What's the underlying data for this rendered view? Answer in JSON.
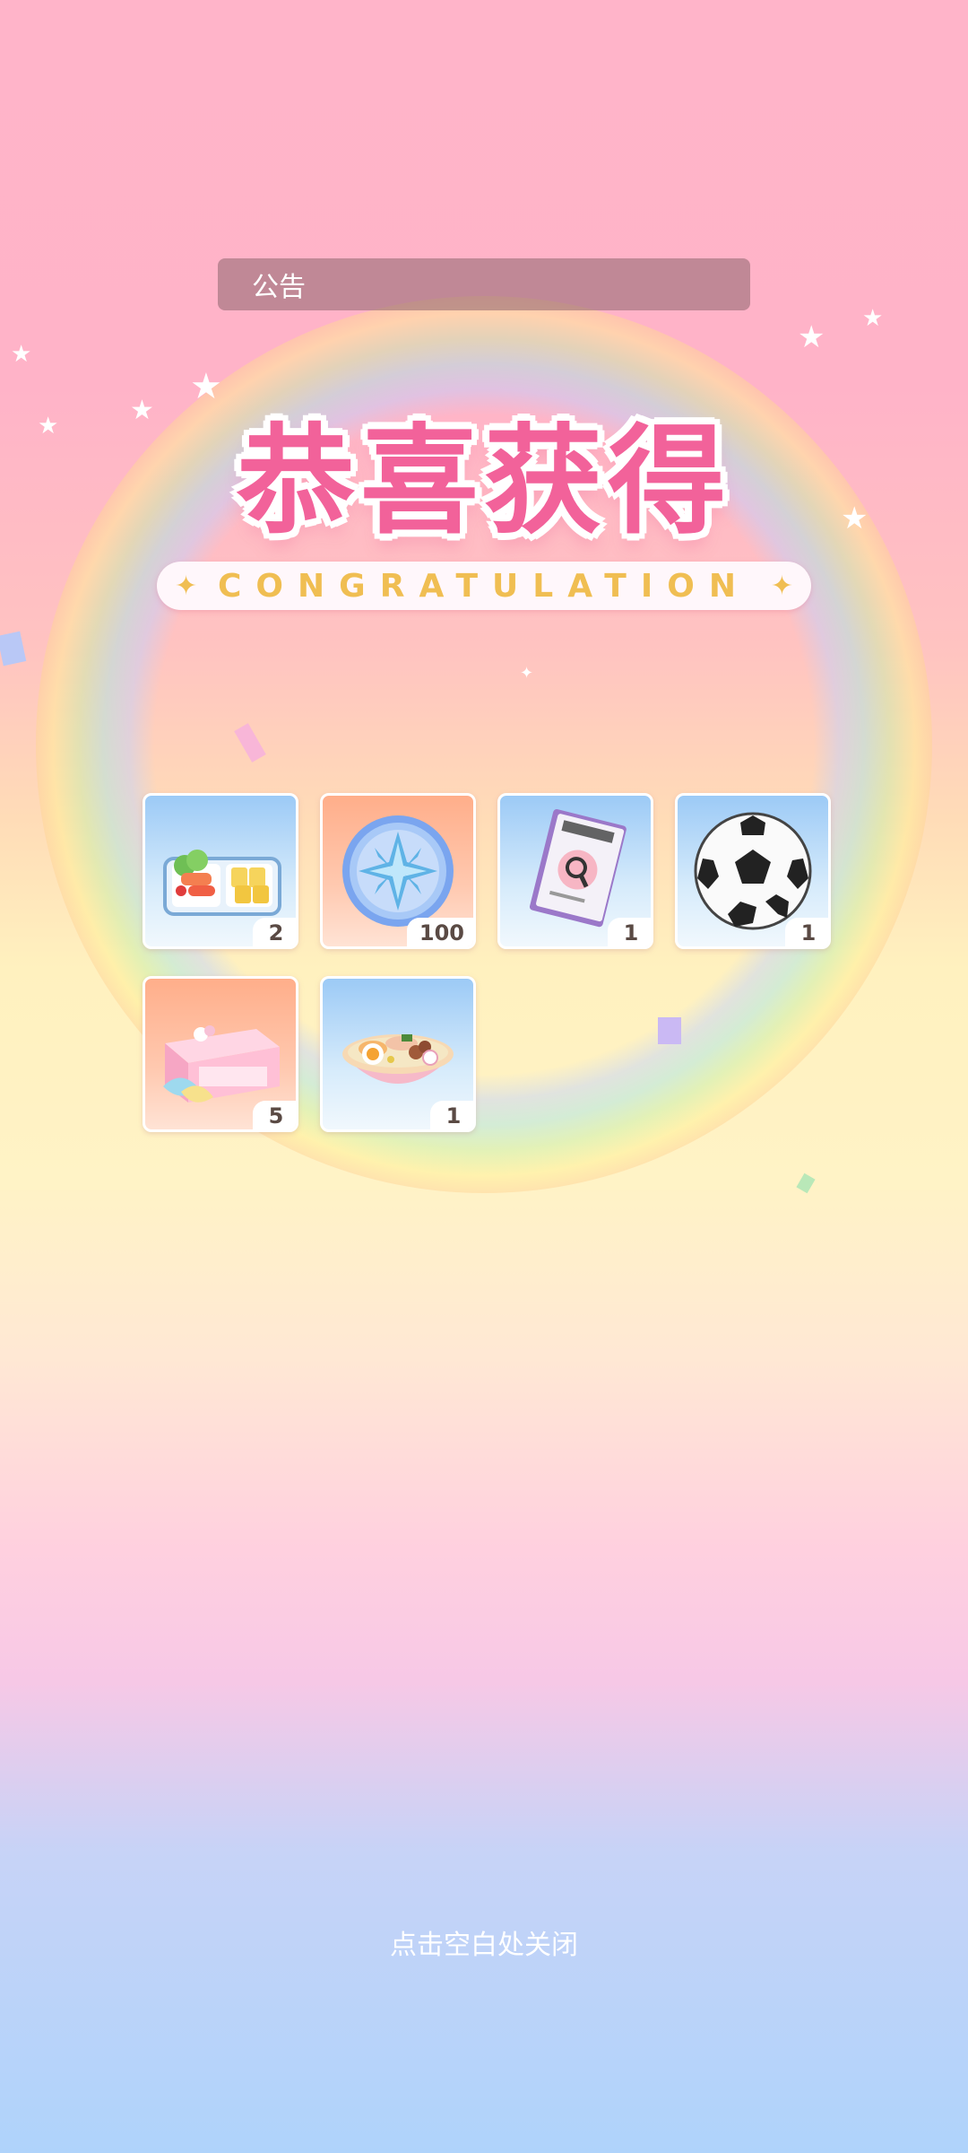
{
  "notice": {
    "label": "公告"
  },
  "title": "恭喜获得",
  "subtitle": "CONGRATULATION",
  "rewards": [
    {
      "name": "bento-box",
      "count": "2",
      "bg": "blue"
    },
    {
      "name": "star-coin",
      "count": "100",
      "bg": "orange"
    },
    {
      "name": "magazine",
      "count": "1",
      "bg": "blue"
    },
    {
      "name": "soccer-ball",
      "count": "1",
      "bg": "blue"
    },
    {
      "name": "gift-box",
      "count": "5",
      "bg": "orange"
    },
    {
      "name": "ramen-bowl",
      "count": "1",
      "bg": "blue"
    }
  ],
  "close_hint": "点击空白处关闭",
  "colors": {
    "title_pink": "#f2629a",
    "subtitle_gold": "#f0be52",
    "notice_bg": "#8c646e"
  }
}
